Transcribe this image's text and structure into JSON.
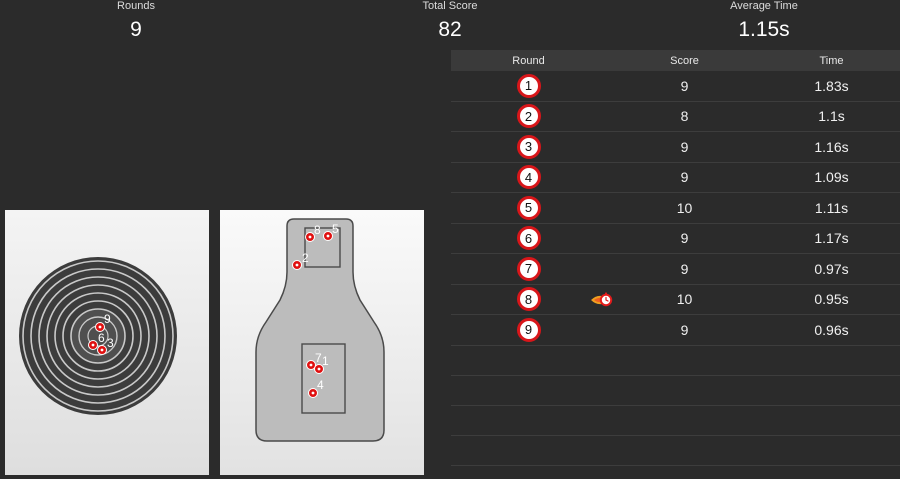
{
  "stats": {
    "rounds": {
      "label": "Rounds",
      "value": "9"
    },
    "total_score": {
      "label": "Total Score",
      "value": "82"
    },
    "average_time": {
      "label": "Average Time",
      "value": "1.15s"
    }
  },
  "table": {
    "headers": {
      "round": "Round",
      "score": "Score",
      "time": "Time"
    },
    "rows": [
      {
        "round": "1",
        "score": "9",
        "time": "1.83s"
      },
      {
        "round": "2",
        "score": "8",
        "time": "1.1s"
      },
      {
        "round": "3",
        "score": "9",
        "time": "1.16s"
      },
      {
        "round": "4",
        "score": "9",
        "time": "1.09s"
      },
      {
        "round": "5",
        "score": "10",
        "time": "1.11s"
      },
      {
        "round": "6",
        "score": "9",
        "time": "1.17s"
      },
      {
        "round": "7",
        "score": "9",
        "time": "0.97s"
      },
      {
        "round": "8",
        "score": "10",
        "time": "0.95s",
        "badge": "fastest-timer-icon"
      },
      {
        "round": "9",
        "score": "9",
        "time": "0.96s"
      }
    ]
  },
  "targets": {
    "bullseye": {
      "icon": "bullseye-target",
      "hit_labels": [
        "9",
        "6",
        "3"
      ]
    },
    "silhouette": {
      "icon": "silhouette-target",
      "hit_labels": [
        "8",
        "5",
        "2",
        "7",
        "1",
        "4"
      ]
    }
  },
  "colors": {
    "background": "#2b2b2b",
    "accent_red": "#d8161a",
    "header_bg": "#3a3a3a"
  }
}
